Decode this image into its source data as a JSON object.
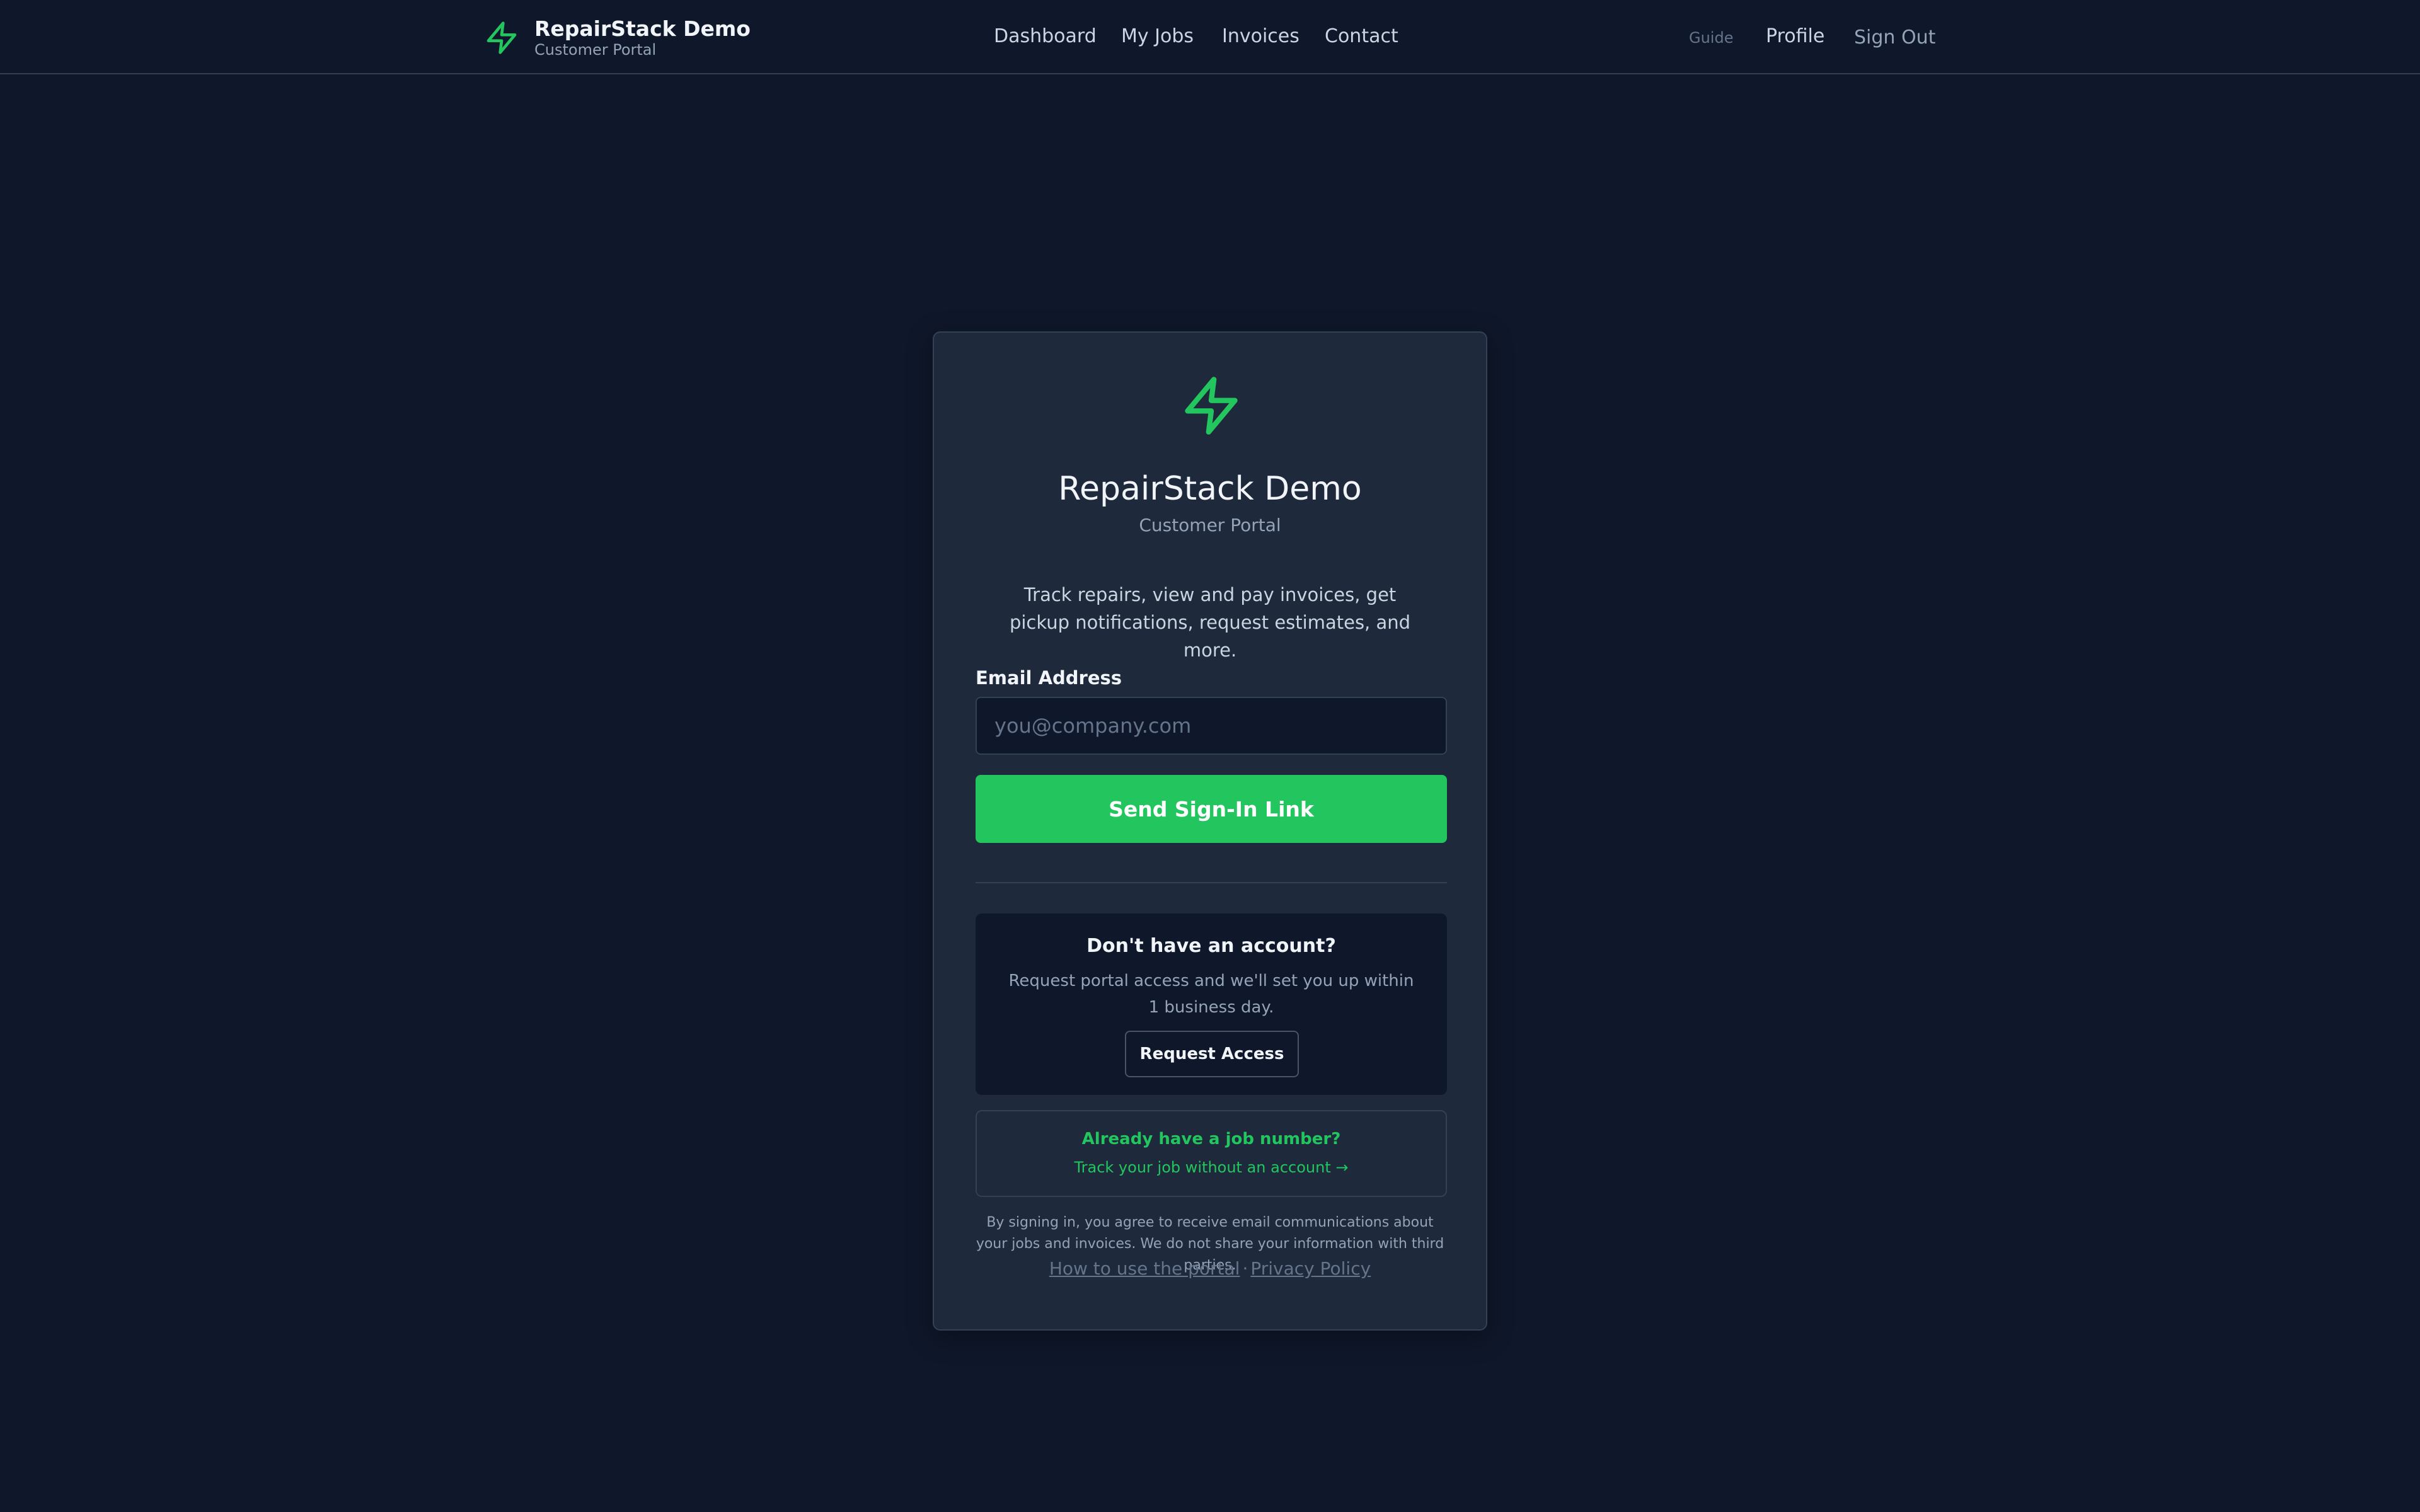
{
  "brand": {
    "name": "RepairStack Demo",
    "subtitle": "Customer Portal",
    "icon": "lightning-bolt-icon"
  },
  "nav": {
    "items": [
      {
        "label": "Dashboard"
      },
      {
        "label": "My Jobs"
      },
      {
        "label": "Invoices"
      },
      {
        "label": "Contact"
      }
    ],
    "guide": "Guide",
    "profile": "Profile",
    "sign_out": "Sign Out"
  },
  "card": {
    "title": "RepairStack Demo",
    "subtitle": "Customer Portal",
    "description": "Track repairs, view and pay invoices, get pickup notifications, request estimates, and more.",
    "email_label": "Email Address",
    "email_placeholder": "you@company.com",
    "email_value": "",
    "send_button": "Send Sign-In Link",
    "signup": {
      "title": "Don't have an account?",
      "text": "Request portal access and we'll set you up within 1 business day.",
      "button": "Request Access"
    },
    "track": {
      "title": "Already have a job number?",
      "link": "Track your job without an account →"
    },
    "legal": "By signing in, you agree to receive email communications about your jobs and invoices. We do not share your information with third parties.",
    "footer_links": {
      "how_to": "How to use the portal",
      "separator": "·",
      "privacy": "Privacy Policy"
    }
  },
  "colors": {
    "background": "#0f172a",
    "card": "#1e293b",
    "accent": "#22c55e",
    "border": "#334155"
  }
}
